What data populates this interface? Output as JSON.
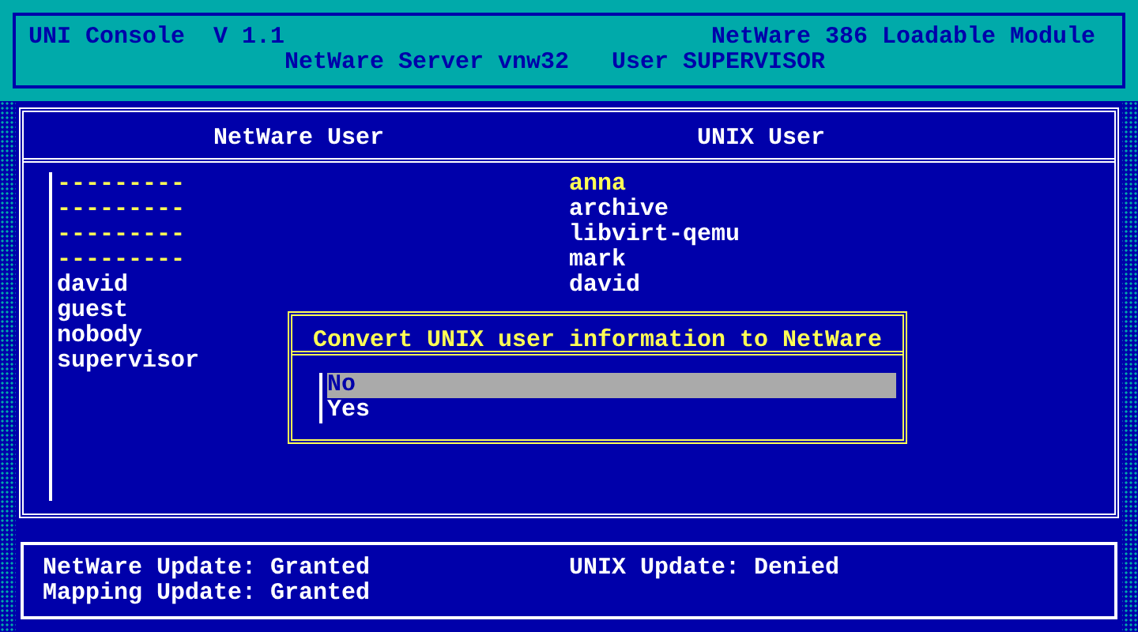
{
  "header": {
    "title": "UNI Console  V 1.1",
    "module": "NetWare 386 Loadable Module",
    "server_line": "NetWare Server vnw32   User SUPERVISOR"
  },
  "table": {
    "columns": [
      "NetWare User",
      "UNIX User"
    ],
    "netware_users": [
      {
        "name": "---------",
        "highlighted": true
      },
      {
        "name": "---------",
        "highlighted": true
      },
      {
        "name": "---------",
        "highlighted": true
      },
      {
        "name": "---------",
        "highlighted": true
      },
      {
        "name": "david",
        "highlighted": false
      },
      {
        "name": "guest",
        "highlighted": false
      },
      {
        "name": "nobody",
        "highlighted": false
      },
      {
        "name": "supervisor",
        "highlighted": false
      }
    ],
    "unix_users": [
      {
        "name": "anna",
        "highlighted": true
      },
      {
        "name": "archive",
        "highlighted": false
      },
      {
        "name": "libvirt-qemu",
        "highlighted": false
      },
      {
        "name": "mark",
        "highlighted": false
      },
      {
        "name": "david",
        "highlighted": false
      }
    ]
  },
  "dialog": {
    "title": "Convert UNIX user information to NetWare",
    "options": [
      {
        "label": "No",
        "selected": true
      },
      {
        "label": "Yes",
        "selected": false
      }
    ]
  },
  "status": [
    {
      "text": "NetWare Update: Granted"
    },
    {
      "text": "UNIX Update: Denied"
    },
    {
      "text": "Mapping Update: Granted"
    }
  ]
}
